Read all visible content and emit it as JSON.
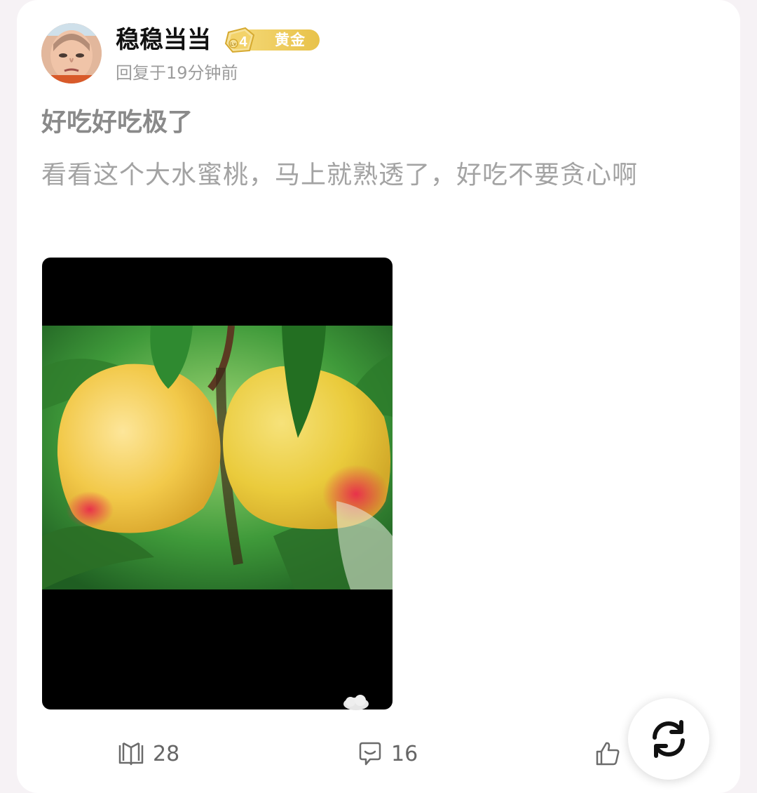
{
  "post": {
    "author": {
      "name": "稳稳当当",
      "level_badge": "4",
      "badge_label": "黄金",
      "avatar_icon": "user-avatar",
      "reply_time": "回复于19分钟前"
    },
    "title": "好吃好吃极了",
    "body": "看看这个大水蜜桃，马上就熟透了，好吃不要贪心啊",
    "image": {
      "description_icon": "peach-photo"
    }
  },
  "actions": {
    "views": {
      "icon": "book-icon",
      "count": "28"
    },
    "comments": {
      "icon": "comment-icon",
      "count": "16"
    },
    "likes": {
      "icon": "thumbs-up-icon",
      "count": ""
    }
  },
  "floating_button": {
    "icon": "refresh-icon"
  },
  "colors": {
    "badge_gold": "#e8c24a",
    "title_gray": "#8a8a8a",
    "body_gray": "#a3a3a3",
    "meta_gray": "#9c9c9c"
  }
}
